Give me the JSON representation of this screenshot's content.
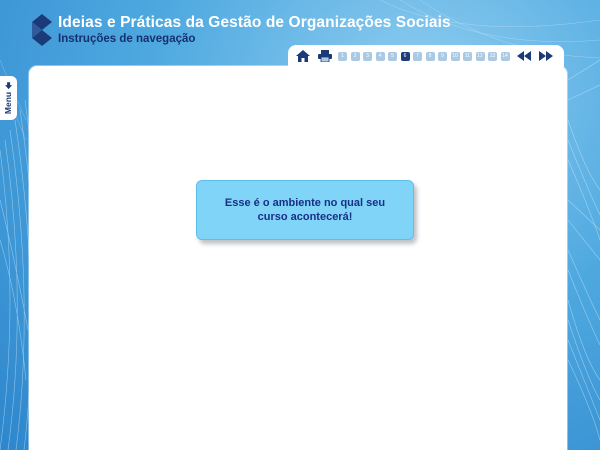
{
  "header": {
    "title": "Ideias e Práticas da Gestão de Organizações Sociais",
    "subtitle": "Instruções de navegação"
  },
  "toolbar": {
    "home_icon": "home-icon",
    "print_icon": "printer-icon",
    "pages": [
      "1",
      "2",
      "3",
      "4",
      "5",
      "6",
      "7",
      "8",
      "9",
      "10",
      "11",
      "12",
      "13",
      "14"
    ],
    "current_page": "6",
    "prev_icon": "double-arrow-left-icon",
    "next_icon": "double-arrow-right-icon"
  },
  "menu": {
    "label": "Menu",
    "icon": "arrow-down-icon"
  },
  "main": {
    "message": "Esse é o ambiente no qual seu curso acontecerá!"
  },
  "colors": {
    "background": "#4fa9e0",
    "title_text": "#ffffff",
    "subtitle_text": "#16306e",
    "message_box": "#7fd4f7",
    "message_text": "#1a2f86",
    "current_page": "#203c78"
  }
}
